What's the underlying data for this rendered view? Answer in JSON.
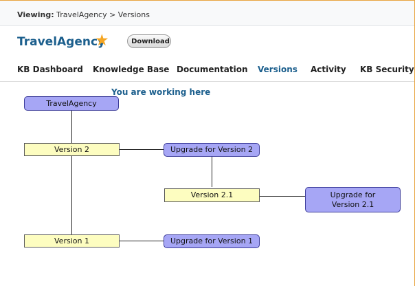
{
  "breadcrumb": {
    "label": "Viewing:",
    "path": "TravelAgency > Versions"
  },
  "header": {
    "title": "TravelAgency",
    "download_label": "Download"
  },
  "nav": {
    "items": [
      {
        "label": "KB Dashboard",
        "active": false
      },
      {
        "label": "Knowledge Base",
        "active": false
      },
      {
        "label": "Documentation",
        "active": false
      },
      {
        "label": "Versions",
        "active": true
      },
      {
        "label": "Activity",
        "active": false
      },
      {
        "label": "KB Security",
        "active": false
      }
    ]
  },
  "diagram": {
    "working_here": "You are working here",
    "nodes": {
      "root": "TravelAgency",
      "version2": "Version 2",
      "upgrade2": "Upgrade for Version 2",
      "version21": "Version 2.1",
      "upgrade21": "Upgrade for Version 2.1",
      "version1": "Version 1",
      "upgrade1": "Upgrade for Version 1"
    }
  },
  "colors": {
    "accent": "#1c5f8d",
    "frame": "#e8a33d",
    "upgrade_node": "#a6a6f5",
    "version_node": "#fdfdc0",
    "star": "#f5a623"
  }
}
